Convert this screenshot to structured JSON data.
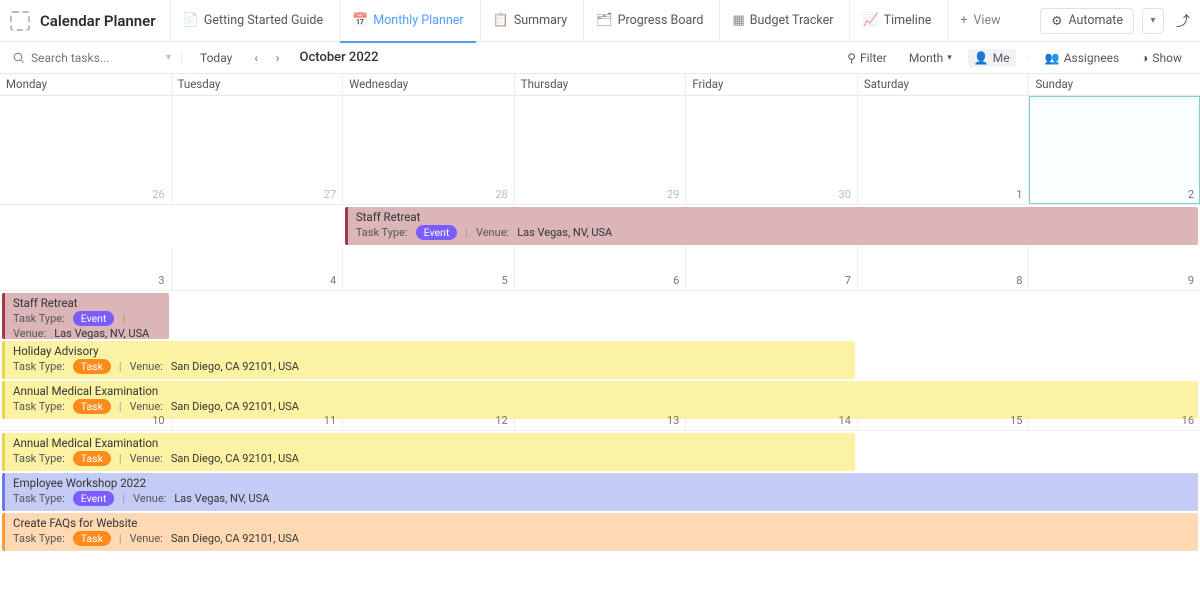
{
  "header": {
    "page_title": "Calendar Planner",
    "tabs": [
      {
        "label": "Getting Started Guide",
        "active": false
      },
      {
        "label": "Monthly Planner",
        "active": true
      },
      {
        "label": "Summary",
        "active": false
      },
      {
        "label": "Progress Board",
        "active": false
      },
      {
        "label": "Budget Tracker",
        "active": false
      },
      {
        "label": "Timeline",
        "active": false
      }
    ],
    "add_view_label": "View",
    "automate_label": "Automate"
  },
  "toolbar": {
    "search_placeholder": "Search tasks...",
    "today_label": "Today",
    "month_label": "October 2022",
    "filter_label": "Filter",
    "view_mode": "Month",
    "me_label": "Me",
    "assignees_label": "Assignees",
    "show_label": "Show"
  },
  "day_headers": [
    "Monday",
    "Tuesday",
    "Wednesday",
    "Thursday",
    "Friday",
    "Saturday",
    "Sunday"
  ],
  "weeks": [
    {
      "dates": [
        {
          "n": "26",
          "muted": true
        },
        {
          "n": "27",
          "muted": true
        },
        {
          "n": "28",
          "muted": true
        },
        {
          "n": "29",
          "muted": true
        },
        {
          "n": "30",
          "muted": true
        },
        {
          "n": "1"
        },
        {
          "n": "2",
          "today": true
        }
      ]
    },
    {
      "dates": [
        {
          "n": "3"
        },
        {
          "n": "4"
        },
        {
          "n": "5"
        },
        {
          "n": "6"
        },
        {
          "n": "7"
        },
        {
          "n": "8"
        },
        {
          "n": "9"
        }
      ]
    },
    {
      "dates": [
        {
          "n": "10"
        },
        {
          "n": "11"
        },
        {
          "n": "12"
        },
        {
          "n": "13"
        },
        {
          "n": "14"
        },
        {
          "n": "15"
        },
        {
          "n": "16"
        }
      ]
    }
  ],
  "labels": {
    "task_type": "Task Type:",
    "venue": "Venue:"
  },
  "events": {
    "w1": [
      {
        "title": "Staff Retreat",
        "type": "Event",
        "venue": "Las Vegas, NV, USA",
        "color": "rose",
        "offset": 2,
        "span": 5
      }
    ],
    "w2": [
      {
        "title": "Staff Retreat",
        "type": "Event",
        "venue": "Las Vegas, NV, USA",
        "color": "rose",
        "offset": 0,
        "span": 1
      },
      {
        "title": "Holiday Advisory",
        "type": "Task",
        "venue": "San Diego, CA 92101, USA",
        "color": "yellow",
        "offset": 0,
        "span": 5
      },
      {
        "title": "Annual Medical Examination",
        "type": "Task",
        "venue": "San Diego, CA 92101, USA",
        "color": "yellow",
        "offset": 0,
        "span": 7
      }
    ],
    "w3": [
      {
        "title": "Annual Medical Examination",
        "type": "Task",
        "venue": "San Diego, CA 92101, USA",
        "color": "yellow",
        "offset": 0,
        "span": 5
      },
      {
        "title": "Employee Workshop 2022",
        "type": "Event",
        "venue": "Las Vegas, NV, USA",
        "color": "blue",
        "offset": 0,
        "span": 7
      },
      {
        "title": "Create FAQs for Website",
        "type": "Task",
        "venue": "San Diego, CA 92101, USA",
        "color": "orange",
        "offset": 0,
        "span": 7
      }
    ]
  }
}
